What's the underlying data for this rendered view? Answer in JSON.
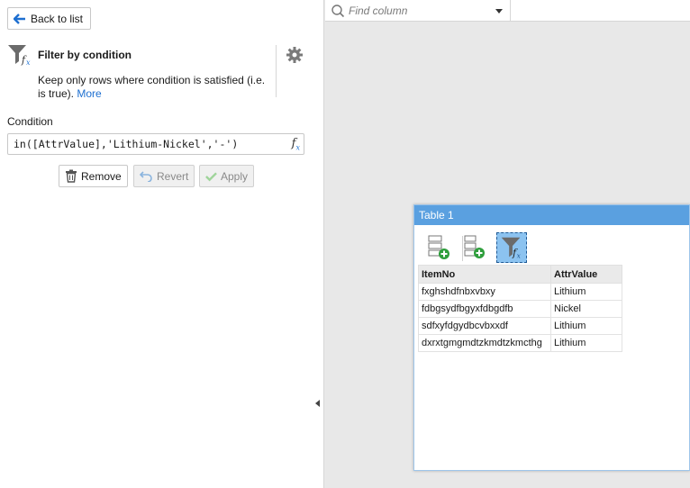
{
  "left_panel": {
    "back_label": "Back to list",
    "filter_title": "Filter by condition",
    "filter_desc": "Keep only rows where condition is satisfied (i.e. is true).",
    "more_label": "More",
    "condition_label": "Condition",
    "condition_value": "in([AttrValue],'Lithium-Nickel','-')",
    "buttons": {
      "remove": "Remove",
      "revert": "Revert",
      "apply": "Apply"
    }
  },
  "find_column": {
    "placeholder": "Find column"
  },
  "table_window": {
    "title": "Table 1",
    "columns": [
      "ItemNo",
      "AttrValue"
    ],
    "rows": [
      [
        "fxghshdfnbxvbxy",
        "Lithium"
      ],
      [
        "fdbgsydfbgyxfdbgdfb",
        "Nickel"
      ],
      [
        "sdfxyfdgydbcvbxxdf",
        "Lithium"
      ],
      [
        "dxrxtgmgmdtzkmdtzkmcthg",
        "Lithium"
      ]
    ]
  },
  "colors": {
    "accent": "#1e6fd0",
    "title_bar": "#5aa0e0",
    "active_tool": "#8cc3f0"
  },
  "icons": [
    "back-arrow-icon",
    "filter-fx-icon",
    "gear-icon",
    "fx-icon",
    "trash-icon",
    "undo-icon",
    "check-icon",
    "search-icon",
    "dropdown-caret-icon",
    "add-step-icon",
    "add-step-alt-icon",
    "filter-condition-icon"
  ]
}
